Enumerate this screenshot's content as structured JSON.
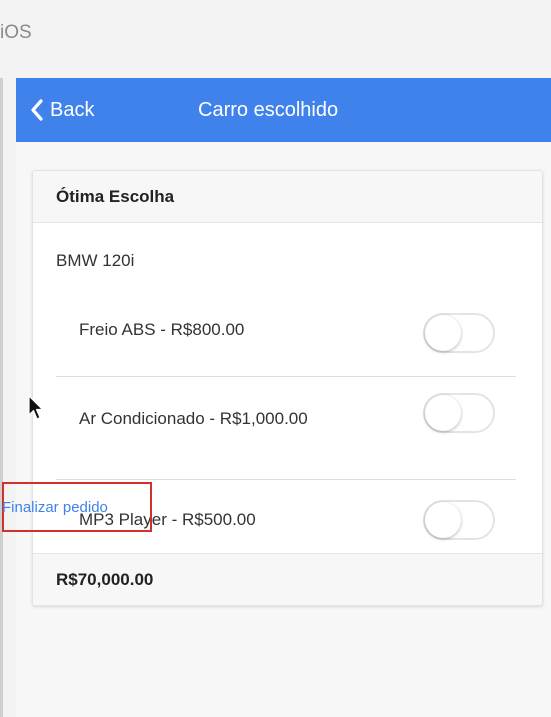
{
  "platform": "iOS",
  "navbar": {
    "back_label": "Back",
    "title": "Carro escolhido"
  },
  "card": {
    "header": "Ótima Escolha",
    "car_name": "BMW 120i",
    "options": [
      {
        "label": "Freio ABS - R$800.00",
        "enabled": false
      },
      {
        "label": "Ar Condicionado - R$1,000.00",
        "enabled": false
      },
      {
        "label": "MP3 Player - R$500.00",
        "enabled": false
      }
    ],
    "total": "R$70,000.00"
  },
  "actions": {
    "finish_label": "Finalizar pedido"
  },
  "colors": {
    "navbar": "#3f82ec",
    "link": "#3f82ec",
    "highlight_border": "#d32f2f"
  }
}
